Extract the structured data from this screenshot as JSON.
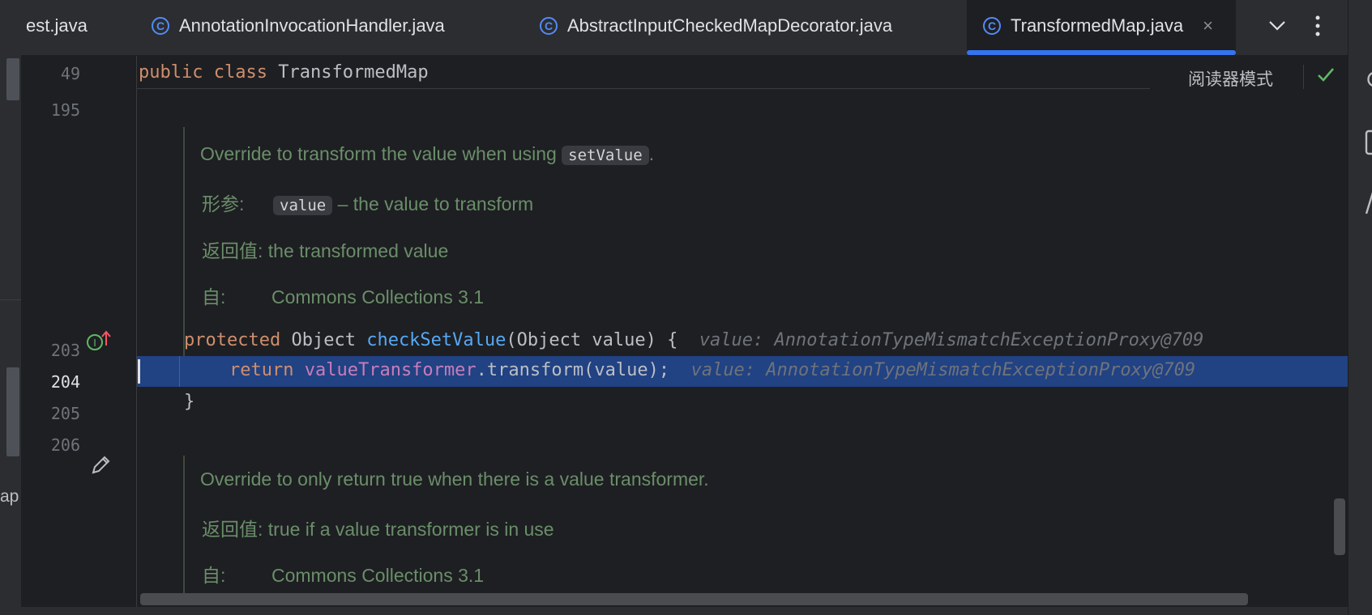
{
  "tabs": [
    {
      "label": "est.java",
      "active": false,
      "icon": "class-icon"
    },
    {
      "label": "AnnotationInvocationHandler.java",
      "active": false,
      "icon": "class-icon"
    },
    {
      "label": "AbstractInputCheckedMapDecorator.java",
      "active": false,
      "icon": "class-icon"
    },
    {
      "label": "TransformedMap.java",
      "active": true,
      "icon": "class-icon"
    }
  ],
  "tab_close_glyph": "×",
  "tabbar_actions": {
    "dropdown_icon": "chevron-down-icon",
    "more_icon": "more-vertical-icon"
  },
  "editor": {
    "sticky": {
      "line": "49",
      "code": {
        "kw1": "public",
        "kw2": "class",
        "name": "TransformedMap"
      }
    },
    "reader_mode": "阅读器模式",
    "line_numbers": [
      "195",
      "203",
      "204",
      "205",
      "206"
    ],
    "doc1": {
      "summary_pre": "Override to transform the value when using ",
      "summary_code": "setValue",
      "summary_post": ".",
      "param_label": "形参:",
      "param_code": "value",
      "param_desc": " – the value to transform",
      "return_label": "返回值:",
      "return_desc": " the transformed value",
      "since_label": "自:",
      "since_value": "Commons Collections 3.1"
    },
    "line203": {
      "kw": "protected",
      "type": "Object",
      "method": "checkSetValue",
      "params": "(Object value) {",
      "hint": "value: AnnotationTypeMismatchExceptionProxy@709"
    },
    "line204": {
      "kw": "return",
      "field": "valueTransformer",
      "rest": ".transform(value);",
      "hint": "value: AnnotationTypeMismatchExceptionProxy@709"
    },
    "line205": "}",
    "doc2": {
      "summary": "Override to only return true when there is a value transformer.",
      "return_label": "返回值:",
      "return_desc": " true if a value transformer is in use",
      "since_label": "自:",
      "since_value": "Commons Collections 3.1"
    }
  },
  "left_strip_text": "ap",
  "colors": {
    "accent": "#3574f0",
    "highlight": "#214283",
    "doc": "#6a8e6a",
    "keyword": "#cf8e6d",
    "method": "#56a8f5",
    "field": "#c77dbb"
  }
}
